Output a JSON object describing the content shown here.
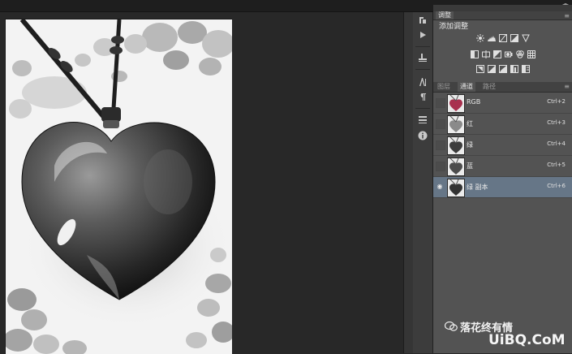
{
  "panels": {
    "adjustments": {
      "tab_label": "调整",
      "title": "添加调整",
      "row1": [
        "brightness-contrast-icon",
        "levels-icon",
        "curves-icon",
        "exposure-icon",
        "vibrance-icon"
      ],
      "row2": [
        "hue-saturation-icon",
        "color-balance-icon",
        "black-white-icon",
        "photo-filter-icon",
        "channel-mixer-icon",
        "color-lookup-icon"
      ],
      "row3": [
        "invert-icon",
        "posterize-icon",
        "threshold-icon",
        "gradient-map-icon",
        "selective-color-icon"
      ]
    },
    "tabs": [
      {
        "label": "图层",
        "active": false
      },
      {
        "label": "通道",
        "active": true
      },
      {
        "label": "路径",
        "active": false
      }
    ],
    "channels": [
      {
        "name": "RGB",
        "shortcut": "Ctrl+2",
        "visible": false,
        "selected": false,
        "tint": "#b0405e"
      },
      {
        "name": "红",
        "shortcut": "Ctrl+3",
        "visible": false,
        "selected": false,
        "tint": "#7a7a7a"
      },
      {
        "name": "绿",
        "shortcut": "Ctrl+4",
        "visible": false,
        "selected": false,
        "tint": "#5a5a5a"
      },
      {
        "name": "蓝",
        "shortcut": "Ctrl+5",
        "visible": false,
        "selected": false,
        "tint": "#6a6a6a"
      },
      {
        "name": "绿 副本",
        "shortcut": "Ctrl+6",
        "visible": true,
        "selected": true,
        "tint": "#4a4a4a"
      }
    ]
  },
  "watermark": {
    "text": "落花终有情",
    "site": "UiBQ.CoM"
  },
  "topbar": {
    "collapse_glyph": "◂▸"
  },
  "colors": {
    "panel_bg": "#535353",
    "selected_row": "#667687",
    "canvas_bg": "#282828"
  }
}
